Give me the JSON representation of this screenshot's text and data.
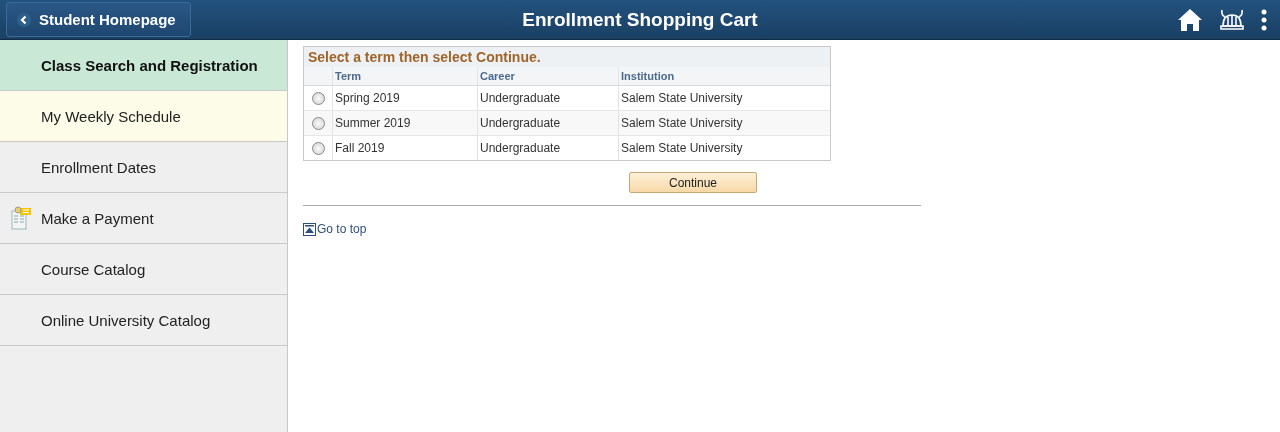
{
  "header": {
    "back_button": "Student Homepage",
    "title": "Enrollment Shopping Cart"
  },
  "sidebar": {
    "items": [
      {
        "label": "Class Search and Registration",
        "selected": true,
        "highlighted": false,
        "has_icon": false
      },
      {
        "label": "My Weekly Schedule",
        "selected": false,
        "highlighted": true,
        "has_icon": false
      },
      {
        "label": "Enrollment Dates",
        "selected": false,
        "highlighted": false,
        "has_icon": false
      },
      {
        "label": "Make a Payment",
        "selected": false,
        "highlighted": false,
        "has_icon": true
      },
      {
        "label": "Course Catalog",
        "selected": false,
        "highlighted": false,
        "has_icon": false
      },
      {
        "label": "Online University Catalog",
        "selected": false,
        "highlighted": false,
        "has_icon": false
      }
    ]
  },
  "term_table": {
    "instruction": "Select a term then select Continue.",
    "columns": [
      "Term",
      "Career",
      "Institution"
    ],
    "rows": [
      {
        "selected": false,
        "cells": [
          "Spring 2019",
          "Undergraduate",
          "Salem State University"
        ]
      },
      {
        "selected": false,
        "cells": [
          "Summer 2019",
          "Undergraduate",
          "Salem State University"
        ]
      },
      {
        "selected": false,
        "cells": [
          "Fall 2019",
          "Undergraduate",
          "Salem State University"
        ]
      }
    ]
  },
  "continue_button": "Continue",
  "go_to_top": "Go to top"
}
